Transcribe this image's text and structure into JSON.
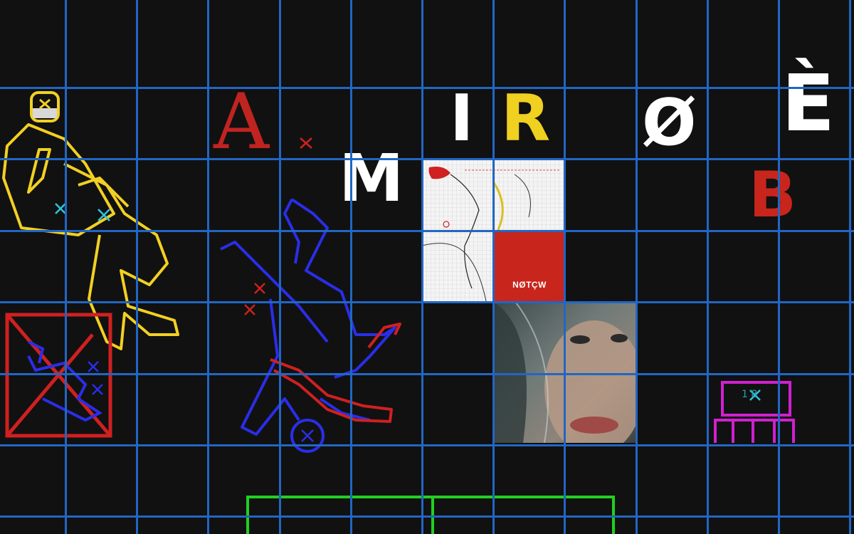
{
  "letters": {
    "a": "A",
    "m": "M",
    "i": "I",
    "r": "R",
    "o_slash": "Ø",
    "e_grave": "È",
    "b": "B"
  },
  "tiles": {
    "red_tile_label": "NØTÇW",
    "screen_number": "1  8"
  },
  "colors": {
    "background": "#111111",
    "grid": "#2266c4",
    "yellow_figure": "#f2d022",
    "blue_figure": "#2a2ee8",
    "red": "#d02020",
    "magenta": "#d020d0",
    "green": "#20d020",
    "cyan_marks": "#2fc5e0"
  }
}
